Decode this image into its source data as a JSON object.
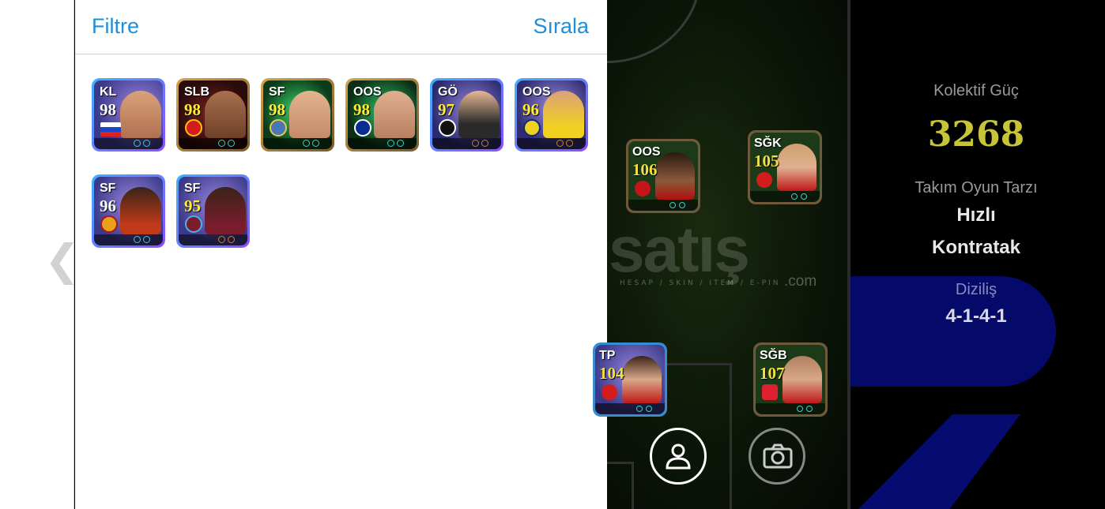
{
  "panel": {
    "filter_label": "Filtre",
    "sort_label": "Sırala"
  },
  "owned_cards": [
    {
      "position": "KL",
      "rating": "98"
    },
    {
      "position": "SLB",
      "rating": "98"
    },
    {
      "position": "SF",
      "rating": "98"
    },
    {
      "position": "OOS",
      "rating": "98"
    },
    {
      "position": "GÖ",
      "rating": "97"
    },
    {
      "position": "OOS",
      "rating": "96"
    },
    {
      "position": "SF",
      "rating": "96"
    },
    {
      "position": "SF",
      "rating": "95"
    }
  ],
  "field_cards": [
    {
      "position": "OOS",
      "rating": "106"
    },
    {
      "position": "SĞK",
      "rating": "105"
    },
    {
      "position": "TP",
      "rating": "104"
    },
    {
      "position": "SĞB",
      "rating": "107"
    }
  ],
  "watermark": {
    "word": "satış",
    "tagline": "HESAP / SKIN / ITEM / E-PIN",
    "domain": ".com"
  },
  "team": {
    "power_label": "Kolektif Güç",
    "power_value": "3268",
    "style_label": "Takım Oyun Tarzı",
    "style_line1": "Hızlı",
    "style_line2": "Kontratak",
    "formation_label": "Diziliş",
    "formation_value": "4-1-4-1"
  },
  "icons": {
    "back": "chevron-left-icon",
    "player": "person-icon",
    "camera": "camera-icon"
  },
  "colors": {
    "link_blue": "#1f8fd6",
    "power_yellow": "#c7c437",
    "accent_navy": "#050a6a"
  }
}
